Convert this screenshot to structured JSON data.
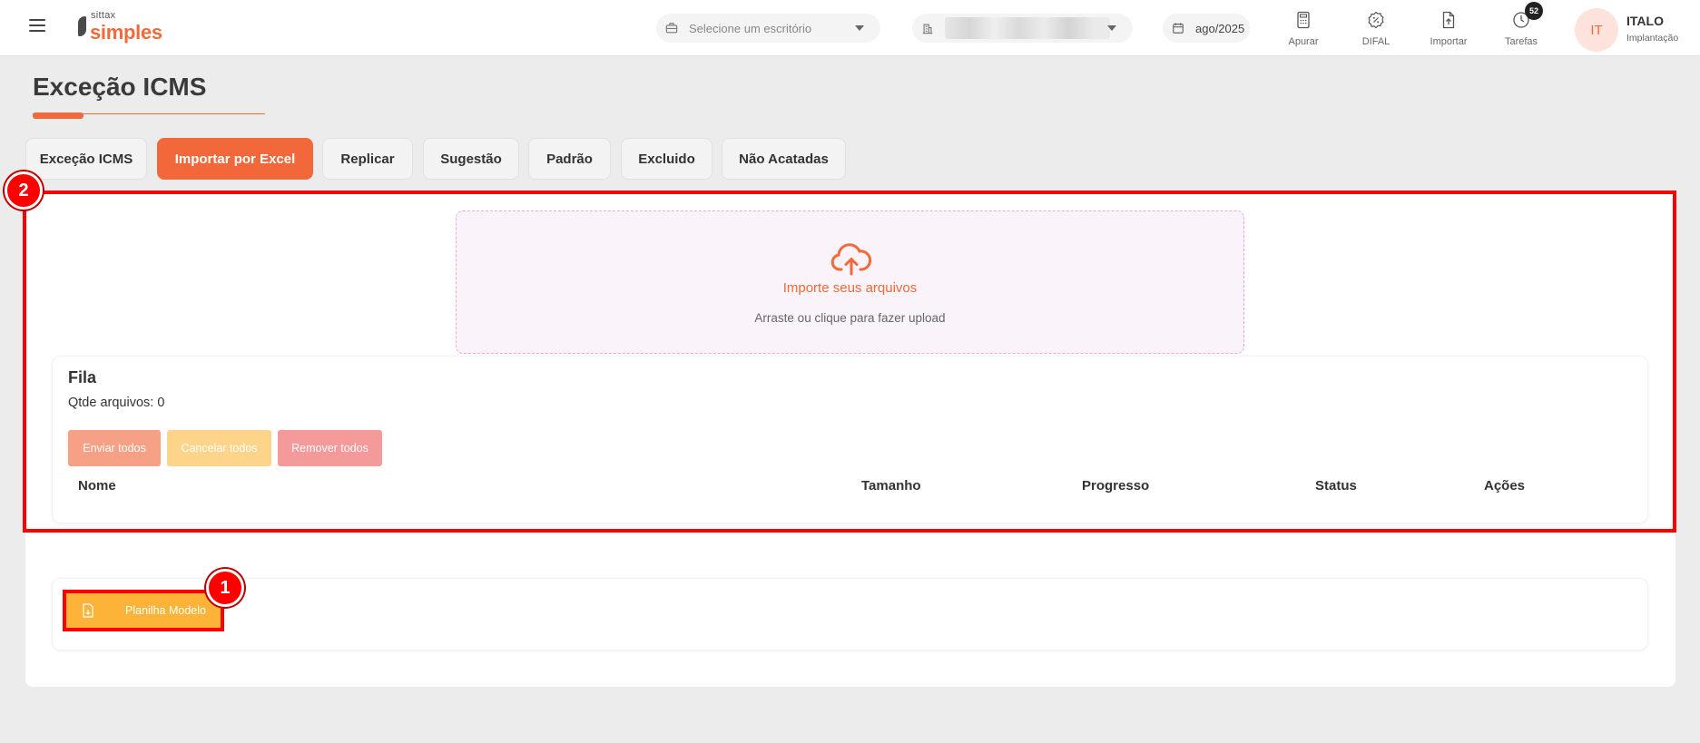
{
  "header": {
    "logo_small": "sittax",
    "logo_big": "simples",
    "office_placeholder": "Selecione um escritório",
    "date": "ago/2025",
    "actions": [
      {
        "label": "Apurar",
        "icon": "calculator-icon"
      },
      {
        "label": "DIFAL",
        "icon": "percent-badge-icon"
      },
      {
        "label": "Importar",
        "icon": "file-upload-icon"
      },
      {
        "label": "Tarefas",
        "icon": "clock-icon",
        "badge": "52"
      }
    ],
    "user": {
      "initials": "IT",
      "name": "ITALO",
      "role": "Implantação"
    }
  },
  "page": {
    "title": "Exceção ICMS"
  },
  "tabs": [
    {
      "label": "Exceção ICMS",
      "active": false
    },
    {
      "label": "Importar por Excel",
      "active": true
    },
    {
      "label": "Replicar",
      "active": false
    },
    {
      "label": "Sugestão",
      "active": false
    },
    {
      "label": "Padrão",
      "active": false
    },
    {
      "label": "Excluido",
      "active": false
    },
    {
      "label": "Não Acatadas",
      "active": false
    }
  ],
  "upload": {
    "title": "Importe seus arquivos",
    "subtitle": "Arraste ou clique para fazer upload"
  },
  "queue": {
    "title": "Fila",
    "count": "Qtde arquivos: 0",
    "buttons": {
      "send": "Enviar todos",
      "cancel": "Cancelar todos",
      "remove": "Remover todos"
    },
    "columns": [
      "Nome",
      "Tamanho",
      "Progresso",
      "Status",
      "Ações"
    ]
  },
  "template": {
    "label": "Planilha Modelo"
  },
  "markers": [
    "1",
    "2"
  ],
  "colors": {
    "accent": "#f06a3a",
    "highlight": "#ff0000",
    "template_button": "#fdb238"
  }
}
